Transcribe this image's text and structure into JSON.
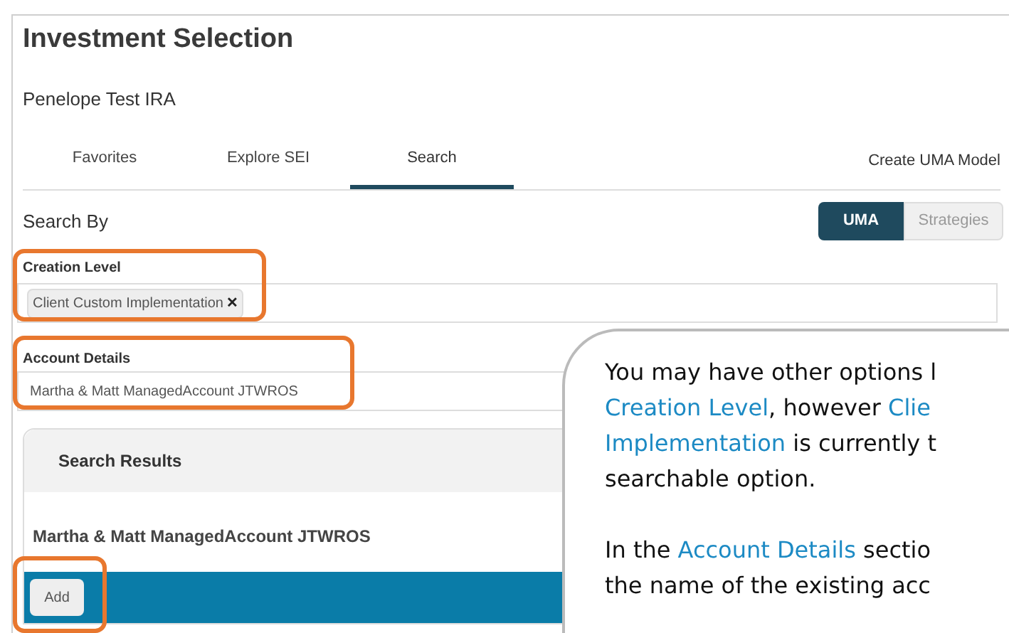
{
  "title": "Investment Selection",
  "account": "Penelope Test IRA",
  "tabs": [
    {
      "label": "Favorites",
      "selected": false
    },
    {
      "label": "Explore SEI",
      "selected": false
    },
    {
      "label": "Search",
      "selected": true
    }
  ],
  "create_link": "Create UMA Model",
  "search_by": {
    "label": "Search By",
    "options": [
      {
        "label": "UMA",
        "selected": true
      },
      {
        "label": "Strategies",
        "selected": false
      }
    ]
  },
  "creation_level": {
    "label": "Creation Level",
    "chip": "Client Custom Implementation",
    "remove": "✕"
  },
  "account_details": {
    "label": "Account Details",
    "value": "Martha & Matt ManagedAccount JTWROS"
  },
  "search_results": {
    "title": "Search Results",
    "result": "Martha & Matt ManagedAccount JTWROS",
    "button": "Add"
  },
  "callout": {
    "paragraphs": [
      [
        [
          {
            "text": "You may have other options l",
            "highlight": false
          }
        ],
        [
          {
            "text": "Creation Level",
            "highlight": true
          },
          {
            "text": ", however ",
            "highlight": false
          },
          {
            "text": "Clie",
            "highlight": true
          }
        ],
        [
          {
            "text": "Implementation",
            "highlight": true
          },
          {
            "text": " is currently t",
            "highlight": false
          }
        ],
        [
          {
            "text": "searchable option.",
            "highlight": false
          }
        ]
      ],
      [
        [
          {
            "text": "In the ",
            "highlight": false
          },
          {
            "text": "Account Details",
            "highlight": true
          },
          {
            "text": " sectio",
            "highlight": false
          }
        ],
        [
          {
            "text": "the name of the existing acc",
            "highlight": false
          }
        ]
      ]
    ]
  }
}
